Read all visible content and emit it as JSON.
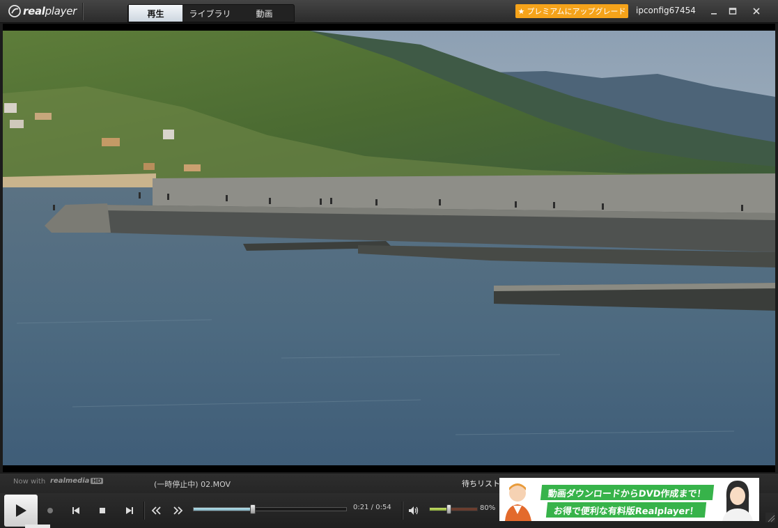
{
  "app": {
    "logo_bold": "real",
    "logo_text": "player"
  },
  "tabs": [
    {
      "label": "再生",
      "active": true
    },
    {
      "label": "ライブラリ",
      "active": false
    },
    {
      "label": "動画",
      "active": false
    }
  ],
  "header": {
    "premium_label": "プレミアムにアップグレード",
    "username": "ipconfig67454"
  },
  "infobar": {
    "now_with": "Now with",
    "realmedia": "realmedia",
    "hd": "HD",
    "status": "(一時停止中) 02.MOV",
    "playlist_label": "待ちリスト"
  },
  "playback": {
    "current_time": "0:21",
    "separator": "/",
    "duration": "0:54",
    "progress_fraction": 0.39,
    "volume_label": "80%",
    "volume_fraction": 0.4
  },
  "ad": {
    "line1": "動画ダウンロードからDVD作成まで！",
    "line2": "お得で便利な有料版Realplayer！"
  },
  "colors": {
    "accent_premium": "#f5a31a",
    "ad_green": "#37b34a",
    "seek_fill": "#7fb3c5",
    "volume_fill": "#8fb33a"
  }
}
